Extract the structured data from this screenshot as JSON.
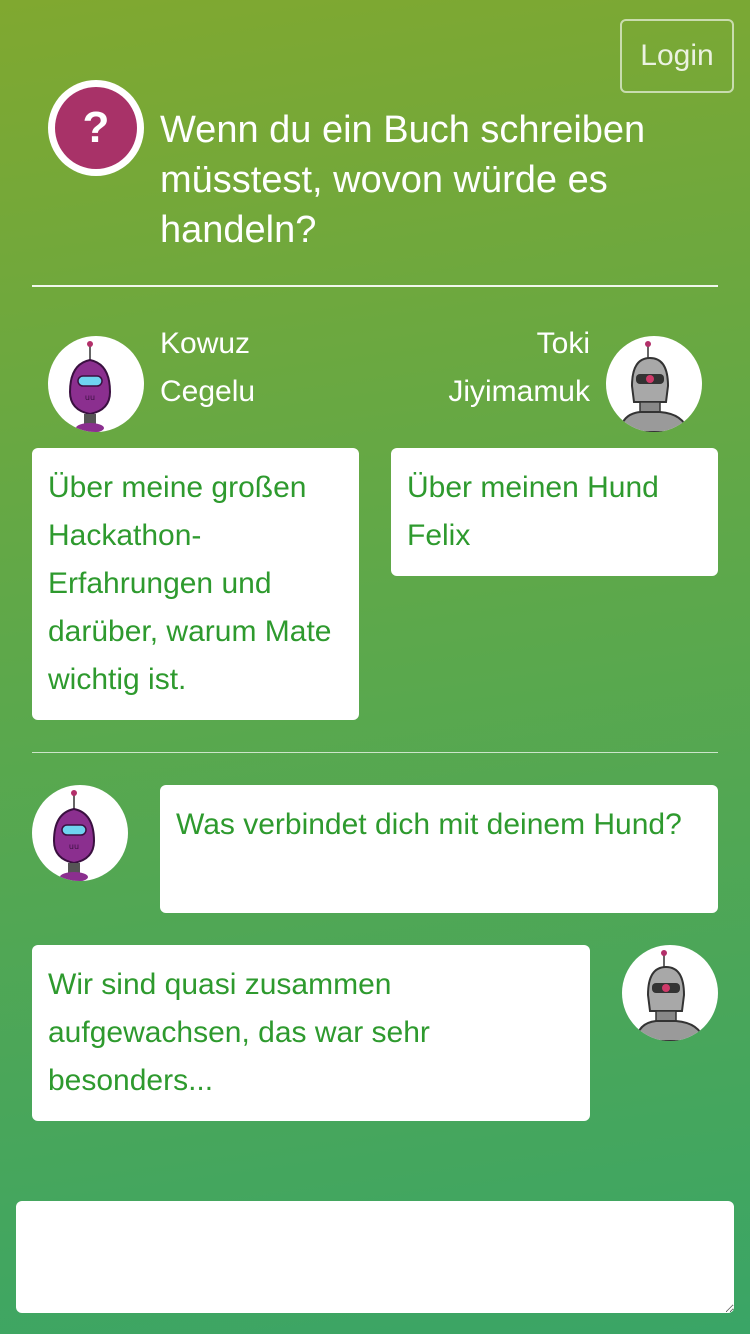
{
  "header": {
    "login_label": "Login"
  },
  "question": {
    "icon": "question-mark-icon",
    "glyph": "?",
    "text": "Wenn du ein Buch schreiben müsstest, wovon würde es handeln?"
  },
  "players": [
    {
      "first_name": "Kowuz",
      "last_name": "Cegelu",
      "avatar": "purple-robot-avatar",
      "color": "#8b2f8f"
    },
    {
      "first_name": "Toki",
      "last_name": "Jiyimamuk",
      "avatar": "grey-robot-avatar",
      "color": "#9a9a9a"
    }
  ],
  "answers": [
    {
      "text": "Über meine großen Hackathon-Erfahrungen und darüber, warum Mate wichtig ist."
    },
    {
      "text": "Über meinen Hund Felix"
    }
  ],
  "chat": [
    {
      "sender": "Kowuz Cegelu",
      "text": "Was verbindet dich mit deinem Hund?"
    },
    {
      "sender": "Toki Jiyimamuk",
      "text": "Wir sind quasi zusammen aufgewachsen, das war sehr besonders..."
    }
  ],
  "input": {
    "value": "",
    "placeholder": ""
  }
}
